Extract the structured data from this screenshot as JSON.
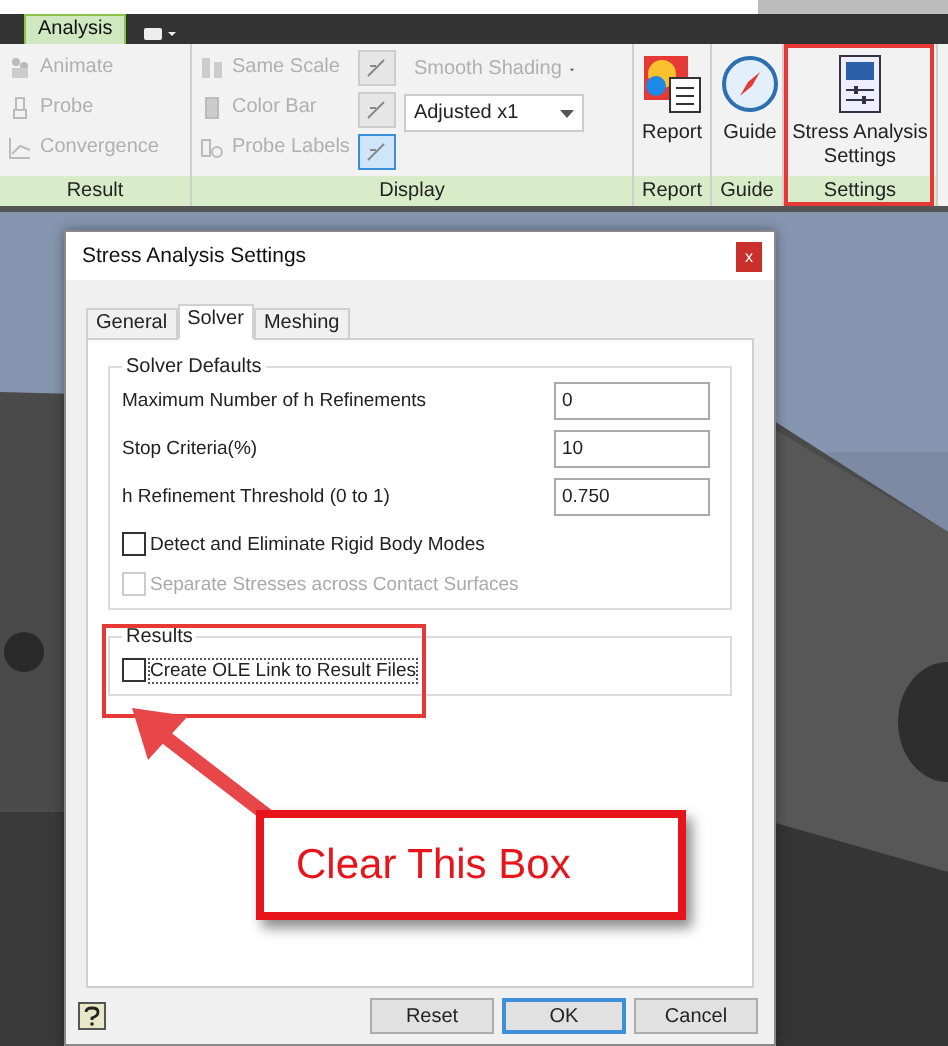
{
  "ribbon": {
    "tabs": [
      {
        "label": "Analysis",
        "selected": true
      }
    ],
    "panels": [
      {
        "title": "Result",
        "kind": "list",
        "items": [
          {
            "label": "Animate",
            "disabled": true
          },
          {
            "label": "Probe",
            "disabled": true
          },
          {
            "label": "Convergence",
            "disabled": true
          }
        ]
      },
      {
        "title": "Display",
        "kind": "display",
        "items": [
          {
            "label": "Same Scale",
            "disabled": true
          },
          {
            "label": "Color Bar",
            "disabled": true
          },
          {
            "label": "Probe Labels",
            "disabled": true
          }
        ],
        "tools": [
          {
            "selected": false
          },
          {
            "selected": false
          },
          {
            "selected": true
          }
        ],
        "dropdowns": [
          {
            "value": "Smooth Shading",
            "disabled": true
          },
          {
            "value": "Adjusted x1",
            "disabled": false
          }
        ]
      },
      {
        "title": "Report",
        "kind": "large",
        "label": "Report"
      },
      {
        "title": "Guide",
        "kind": "large",
        "label": "Guide"
      },
      {
        "title": "Settings",
        "kind": "large",
        "label": "Stress Analysis Settings",
        "highlighted": true
      }
    ]
  },
  "dialog": {
    "title": "Stress Analysis Settings",
    "close": "x",
    "tabs": [
      {
        "label": "General",
        "selected": false
      },
      {
        "label": "Solver",
        "selected": true
      },
      {
        "label": "Meshing",
        "selected": false
      }
    ],
    "groups": [
      {
        "title": "Solver Defaults",
        "fields": [
          {
            "label": "Maximum Number of h Refinements",
            "value": "0"
          },
          {
            "label": "Stop Criteria(%)",
            "value": "10"
          },
          {
            "label": "h Refinement Threshold (0 to 1)",
            "value": "0.750"
          }
        ],
        "checkboxes": [
          {
            "label": "Detect and Eliminate Rigid Body Modes",
            "checked": false,
            "disabled": false,
            "focused": false
          },
          {
            "label": "Separate Stresses across Contact Surfaces",
            "checked": false,
            "disabled": true,
            "focused": false
          }
        ]
      },
      {
        "title": "Results",
        "highlighted": true,
        "checkboxes": [
          {
            "label": "Create OLE Link to Result Files",
            "checked": false,
            "disabled": false,
            "focused": true
          }
        ]
      }
    ],
    "buttons": [
      {
        "label": "Reset",
        "default": false
      },
      {
        "label": "OK",
        "default": true
      },
      {
        "label": "Cancel",
        "default": false
      }
    ]
  },
  "callout": {
    "text": "Clear This Box"
  }
}
